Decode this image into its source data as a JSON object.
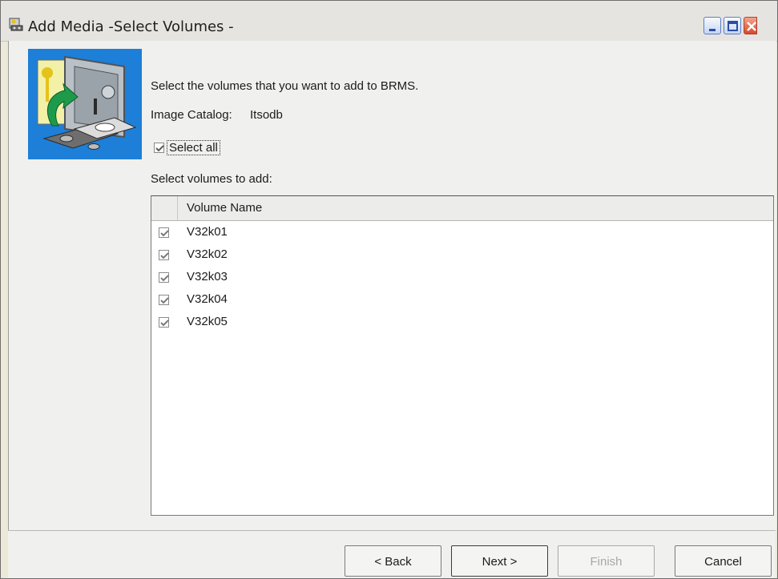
{
  "window": {
    "title": "Add Media -Select Volumes -"
  },
  "intro": {
    "instruction": "Select the volumes that you want to add to BRMS.",
    "catalog_label": "Image Catalog:",
    "catalog_value": "Itsodb",
    "select_all_label": "Select all",
    "select_all_checked": true,
    "list_label": "Select volumes to add:"
  },
  "table": {
    "column_header": "Volume Name",
    "rows": [
      {
        "name": "V32k01",
        "checked": true
      },
      {
        "name": "V32k02",
        "checked": true
      },
      {
        "name": "V32k03",
        "checked": true
      },
      {
        "name": "V32k04",
        "checked": true
      },
      {
        "name": "V32k05",
        "checked": true
      }
    ]
  },
  "buttons": {
    "back": "< Back",
    "next": "Next >",
    "finish": "Finish",
    "cancel": "Cancel"
  }
}
